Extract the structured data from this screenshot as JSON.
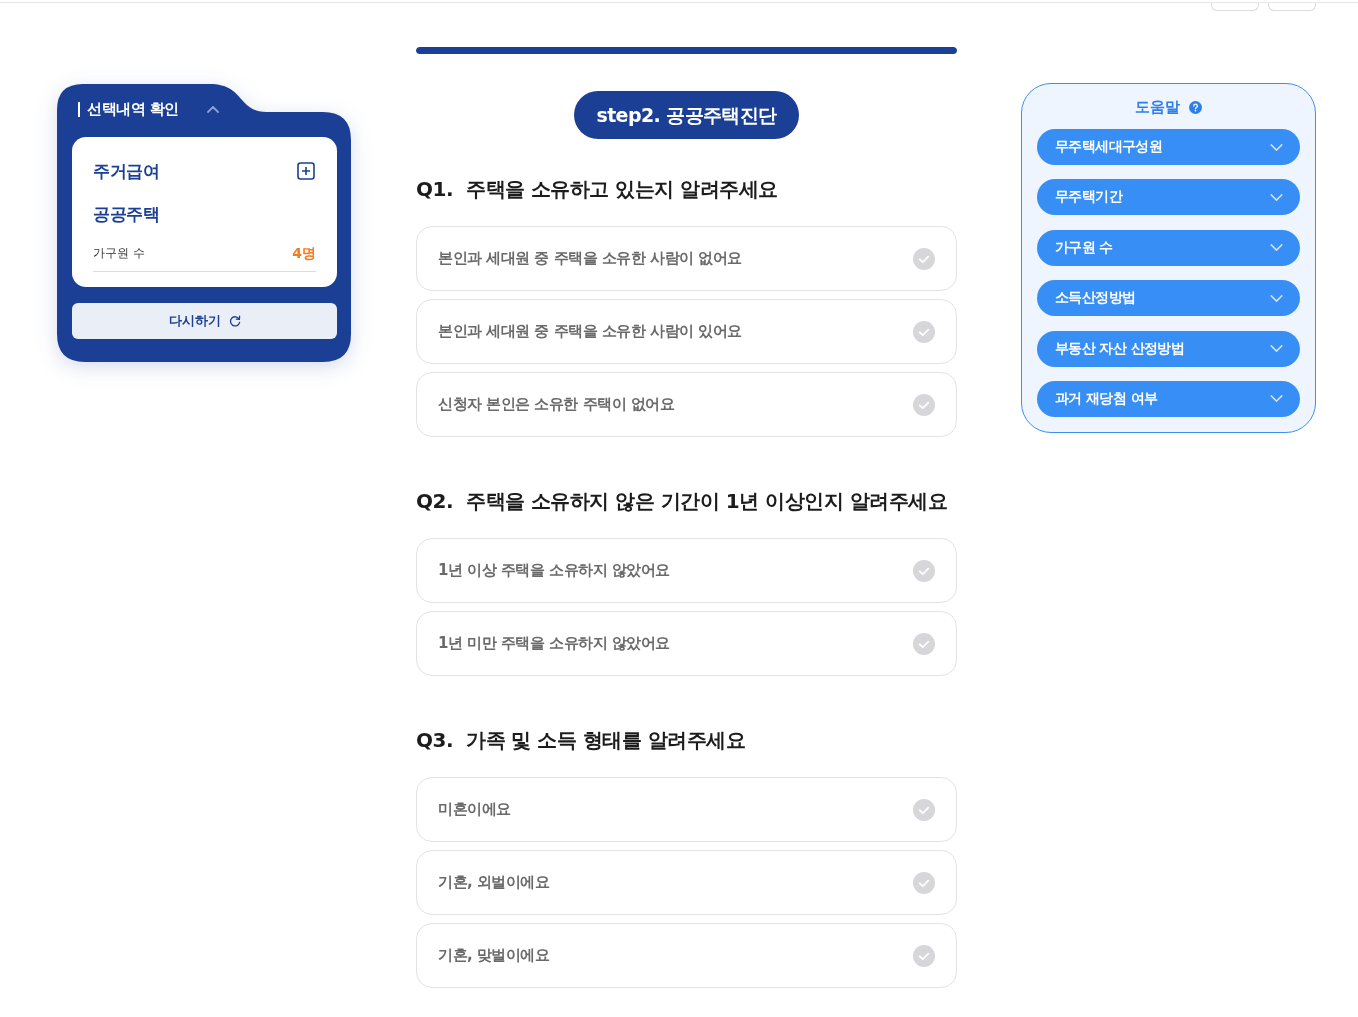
{
  "selection_panel": {
    "title": "선택내역 확인",
    "expanded": true,
    "items": [
      {
        "label": "주거급여",
        "addable": true
      },
      {
        "label": "공공주택",
        "addable": false
      }
    ],
    "details": [
      {
        "label": "가구원 수",
        "value": "4명"
      }
    ],
    "reset_button": "다시하기"
  },
  "progress": {
    "level": 1
  },
  "step_badge": "step2. 공공주택진단",
  "questions": [
    {
      "number": "Q1.",
      "title": "주택을 소유하고 있는지 알려주세요",
      "options": [
        {
          "label": "본인과 세대원 중 주택을 소유한 사람이 없어요",
          "selected": false
        },
        {
          "label": "본인과 세대원 중 주택을 소유한 사람이 있어요",
          "selected": false
        },
        {
          "label": "신청자 본인은 소유한 주택이 없어요",
          "selected": false
        }
      ]
    },
    {
      "number": "Q2.",
      "title": "주택을 소유하지 않은 기간이 1년 이상인지 알려주세요",
      "options": [
        {
          "label": "1년 이상 주택을 소유하지 않았어요",
          "selected": false
        },
        {
          "label": "1년 미만 주택을 소유하지 않았어요",
          "selected": false
        }
      ]
    },
    {
      "number": "Q3.",
      "title": "가족 및 소득 형태를 알려주세요",
      "options": [
        {
          "label": "미혼이에요",
          "selected": false
        },
        {
          "label": "기혼, 외벌이에요",
          "selected": false
        },
        {
          "label": "기혼, 맞벌이에요",
          "selected": false
        }
      ]
    }
  ],
  "help": {
    "title": "도움말",
    "items": [
      {
        "label": "무주택세대구성원",
        "expanded": false
      },
      {
        "label": "무주택기간",
        "expanded": false
      },
      {
        "label": "가구원 수",
        "expanded": false
      },
      {
        "label": "소득산정방법",
        "expanded": false
      },
      {
        "label": "부동산 자산 산정방법",
        "expanded": false
      },
      {
        "label": "과거 재당첨 여부",
        "expanded": false
      }
    ]
  }
}
